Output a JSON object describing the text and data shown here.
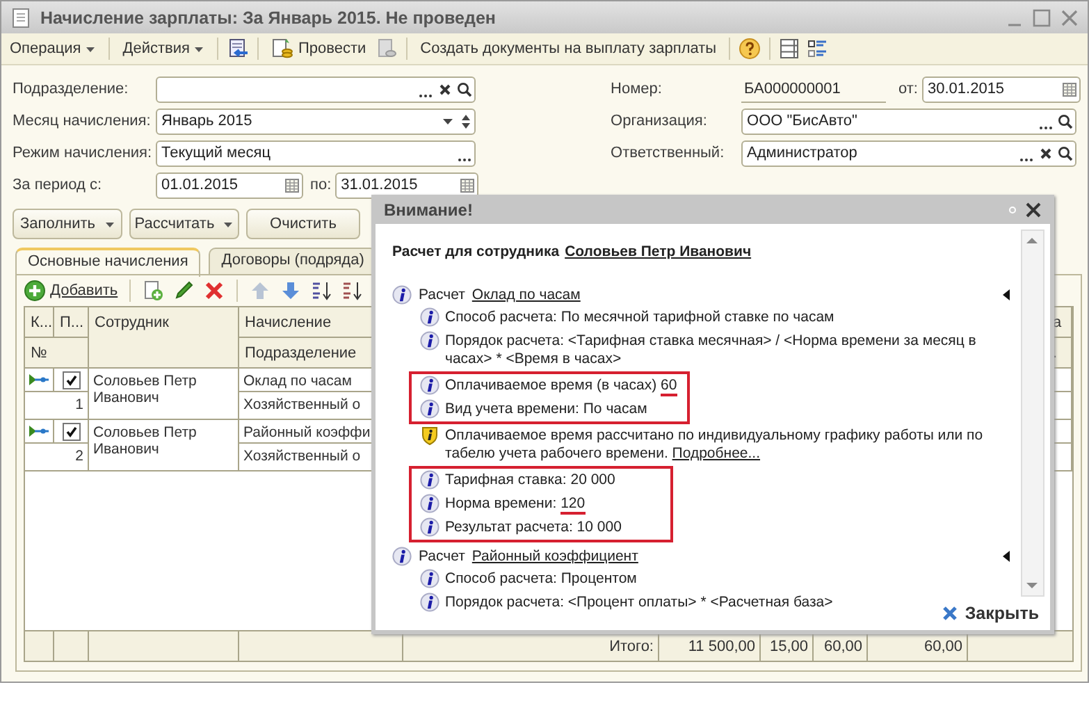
{
  "window": {
    "title": "Начисление зарплаты: За Январь 2015. Не проведен"
  },
  "toolbar": {
    "operation_menu": "Операция",
    "actions_menu": "Действия",
    "post_button": "Провести",
    "create_button": "Создать документы на выплату зарплаты"
  },
  "form": {
    "subdivision": {
      "label": "Подразделение:"
    },
    "month": {
      "label": "Месяц начисления:",
      "value": "Январь 2015"
    },
    "mode": {
      "label": "Режим начисления:",
      "value": "Текущий месяц"
    },
    "period": {
      "label": "За период с:",
      "from": "01.01.2015",
      "to_label": "по:",
      "to": "31.01.2015"
    },
    "number": {
      "label": "Номер:",
      "value": "БА000000001",
      "date_label": "от:",
      "date": "30.01.2015"
    },
    "organization": {
      "label": "Организация:",
      "value": "ООО \"БисАвто\""
    },
    "responsible": {
      "label": "Ответственный:",
      "value": "Администратор"
    }
  },
  "actions": [
    {
      "label": "Заполнить",
      "dropdown": true
    },
    {
      "label": "Рассчитать",
      "dropdown": true
    },
    {
      "label": "Очистить",
      "dropdown": false
    }
  ],
  "tabs": [
    {
      "label": "Основные начисления",
      "selected": true
    },
    {
      "label": "Договоры (подряда)",
      "selected": false
    }
  ],
  "table_toolbar": {
    "add_button": "Добавить"
  },
  "table": {
    "columns": {
      "column_1": "К...",
      "column_2": "П...",
      "employee": "Сотрудник",
      "accrual": "Начисление",
      "number": "№",
      "department": "Подразделение",
      "column_5": "а",
      "column_5_line_2": "."
    },
    "rows": [
      {
        "checked": true,
        "employee": "Соловьев Петр Иванович",
        "number": "1",
        "accrual": "Оклад по часам",
        "department": "Хозяйственный о"
      },
      {
        "checked": true,
        "employee": "Соловьев Петр Иванович",
        "number": "2",
        "accrual": "Районный коэффи",
        "department": "Хозяйственный о"
      }
    ],
    "totals": {
      "label": "Итого:",
      "values": [
        "11 500,00",
        "15,00",
        "60,00",
        "60,00"
      ]
    }
  },
  "dialog": {
    "title": "Внимание!",
    "heading": "Расчет для сотрудника",
    "employee_link": "Соловьев Петр Иванович",
    "groups": [
      {
        "label": "Расчет",
        "link": "Оклад по часам",
        "items": [
          {
            "kind": "info",
            "text": "Способ расчета: По месячной тарифной ставке по часам",
            "framed": false
          },
          {
            "kind": "info",
            "text": "Порядок расчета: <Тарифная ставка месячная> / <Норма времени за месяц в часах> * <Время в часах>",
            "framed": false
          },
          {
            "kind": "info",
            "text": "Оплачиваемое время (в часах)",
            "value": "60",
            "value_marked": true,
            "framed": true
          },
          {
            "kind": "info",
            "text": "Вид учета времени: По часам",
            "framed": true
          },
          {
            "kind": "warning",
            "text": "Оплачиваемое время рассчитано по индивидуальному графику работы или по табелю учета рабочего времени.",
            "link": "Подробнее...",
            "framed": false
          },
          {
            "kind": "info",
            "text": "Тарифная ставка: 20 000",
            "framed": true
          },
          {
            "kind": "info",
            "text": "Норма времени:",
            "value": "120",
            "value_marked": true,
            "framed": true
          },
          {
            "kind": "info",
            "text": "Результат расчета: 10 000",
            "framed": true
          }
        ]
      },
      {
        "label": "Расчет",
        "link": "Районный коэффициент",
        "items": [
          {
            "kind": "info",
            "text": "Способ расчета: Процентом",
            "framed": false
          },
          {
            "kind": "info",
            "text": "Порядок расчета: <Процент оплаты> * <Расчетная база>",
            "framed": false
          }
        ]
      }
    ],
    "close_button": "Закрыть"
  }
}
